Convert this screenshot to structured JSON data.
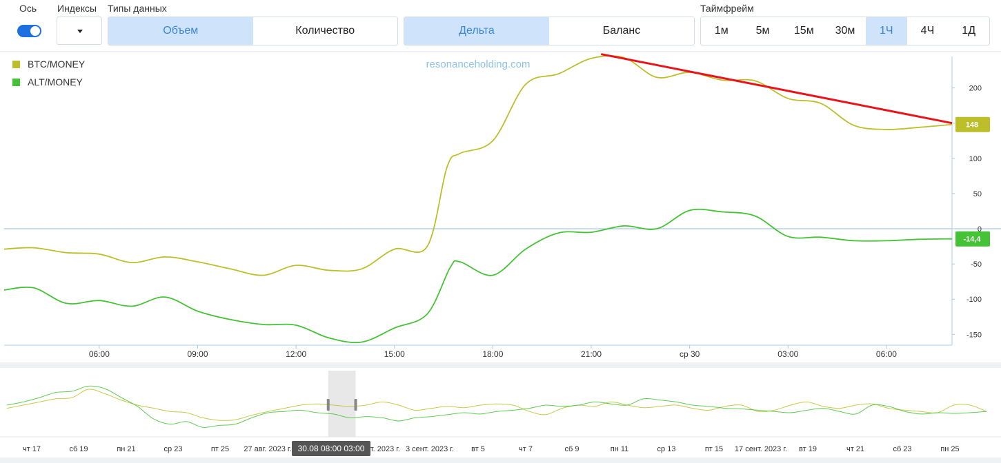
{
  "controls": {
    "axis_label": "Ось",
    "indexes_label": "Индексы",
    "data_types_label": "Типы данных",
    "timeframe_label": "Таймфрейм",
    "data_types": [
      {
        "label": "Объем",
        "active": true
      },
      {
        "label": "Количество",
        "active": false
      }
    ],
    "views": [
      {
        "label": "Дельта",
        "active": true
      },
      {
        "label": "Баланс",
        "active": false
      }
    ],
    "timeframes": [
      {
        "label": "1м",
        "active": false
      },
      {
        "label": "5м",
        "active": false
      },
      {
        "label": "15м",
        "active": false
      },
      {
        "label": "30м",
        "active": false
      },
      {
        "label": "1Ч",
        "active": true
      },
      {
        "label": "4Ч",
        "active": false
      },
      {
        "label": "1Д",
        "active": false
      }
    ]
  },
  "watermark": "resonanceholding.com",
  "colors": {
    "btc": "#bcbf2a",
    "alt": "#45c236",
    "trend": "#e8141b",
    "accent": "#1e6fe0",
    "active_bg": "#cfe4fb",
    "active_text": "#3b86d8",
    "axis": "#a9cbeb",
    "zero_line": "#8fb8de"
  },
  "chart_data": {
    "type": "line",
    "xlabel": "",
    "ylabel": "",
    "ylim": [
      -165,
      250
    ],
    "y_ticks": [
      200,
      150,
      100,
      50,
      0,
      -50,
      -100,
      -150
    ],
    "x_ticks": [
      {
        "label": "06:00",
        "x": 6
      },
      {
        "label": "09:00",
        "x": 9
      },
      {
        "label": "12:00",
        "x": 12
      },
      {
        "label": "15:00",
        "x": 15
      },
      {
        "label": "18:00",
        "x": 18
      },
      {
        "label": "21:00",
        "x": 21
      },
      {
        "label": "ср 30",
        "x": 24
      },
      {
        "label": "03:00",
        "x": 27
      },
      {
        "label": "06:00",
        "x": 30
      }
    ],
    "xlim": [
      3.1,
      32
    ],
    "legend": "top-left",
    "series": [
      {
        "name": "BTC/MONEY",
        "color": "#bcbf2a",
        "last_label": "148",
        "points": [
          [
            3.1,
            -29
          ],
          [
            4,
            -27
          ],
          [
            5,
            -34
          ],
          [
            6,
            -36
          ],
          [
            7,
            -48
          ],
          [
            8,
            -40
          ],
          [
            9,
            -47
          ],
          [
            10,
            -57
          ],
          [
            11,
            -66
          ],
          [
            12,
            -52
          ],
          [
            13,
            -59
          ],
          [
            14,
            -57
          ],
          [
            15,
            -29
          ],
          [
            16,
            -25
          ],
          [
            16.6,
            87
          ],
          [
            17,
            107
          ],
          [
            18,
            125
          ],
          [
            19,
            205
          ],
          [
            20,
            220
          ],
          [
            21,
            242
          ],
          [
            22,
            243
          ],
          [
            23,
            215
          ],
          [
            24,
            222
          ],
          [
            25,
            211
          ],
          [
            26,
            210
          ],
          [
            27,
            185
          ],
          [
            28,
            178
          ],
          [
            29,
            147
          ],
          [
            30,
            141
          ],
          [
            31,
            144
          ],
          [
            32,
            148
          ]
        ]
      },
      {
        "name": "ALT/MONEY",
        "color": "#45c236",
        "last_label": "-14,4",
        "points": [
          [
            3.1,
            -87
          ],
          [
            4,
            -84
          ],
          [
            5,
            -106
          ],
          [
            6,
            -102
          ],
          [
            7,
            -110
          ],
          [
            8,
            -97
          ],
          [
            9,
            -117
          ],
          [
            10,
            -129
          ],
          [
            11,
            -136
          ],
          [
            12,
            -137
          ],
          [
            13,
            -155
          ],
          [
            14,
            -161
          ],
          [
            15,
            -141
          ],
          [
            16,
            -121
          ],
          [
            16.7,
            -55
          ],
          [
            17,
            -47
          ],
          [
            18,
            -66
          ],
          [
            19,
            -29
          ],
          [
            20,
            -6
          ],
          [
            21,
            -5
          ],
          [
            22,
            4
          ],
          [
            23,
            0
          ],
          [
            24,
            26
          ],
          [
            25,
            24
          ],
          [
            26,
            18
          ],
          [
            27,
            -11
          ],
          [
            28,
            -12
          ],
          [
            29,
            -17
          ],
          [
            30,
            -17
          ],
          [
            31,
            -15
          ],
          [
            32,
            -14.4
          ]
        ]
      }
    ],
    "annotations": [
      {
        "type": "trendline",
        "color": "#e8141b",
        "from": [
          21.3,
          248
        ],
        "to": [
          32,
          150
        ]
      }
    ],
    "navigator": {
      "x_ticks": [
        "чт 17",
        "сб 19",
        "пн 21",
        "ср 23",
        "пт 25",
        "27 авг. 2023 г.",
        "30.08 08:00 03:00",
        "1 сент. 2023 г.",
        "3 сент. 2023 г.",
        "вт 5",
        "чт 7",
        "сб 9",
        "пн 11",
        "ср 13",
        "пт 15",
        "17 сент. 2023 г.",
        "вт 19",
        "чт 21",
        "сб 23",
        "пн 25"
      ],
      "cursor_label": "30.08 08:00 03:00",
      "selection": [
        0.328,
        0.356
      ],
      "series": [
        {
          "name": "BTC/MONEY",
          "values": [
            0.45,
            0.5,
            0.55,
            0.6,
            0.62,
            0.75,
            0.68,
            0.58,
            0.5,
            0.45,
            0.4,
            0.38,
            0.3,
            0.26,
            0.27,
            0.34,
            0.4,
            0.45,
            0.5,
            0.52,
            0.5,
            0.48,
            0.5,
            0.55,
            0.5,
            0.42,
            0.45,
            0.48,
            0.46,
            0.5,
            0.52,
            0.5,
            0.4,
            0.35,
            0.45,
            0.5,
            0.48,
            0.55,
            0.5,
            0.46,
            0.48,
            0.5,
            0.45,
            0.42,
            0.48,
            0.5,
            0.4,
            0.42,
            0.5,
            0.55,
            0.48,
            0.45,
            0.5,
            0.52,
            0.45,
            0.42,
            0.4,
            0.38,
            0.5,
            0.5,
            0.4
          ]
        },
        {
          "name": "ALT/MONEY",
          "values": [
            0.5,
            0.55,
            0.62,
            0.7,
            0.72,
            0.8,
            0.76,
            0.62,
            0.48,
            0.28,
            0.2,
            0.24,
            0.15,
            0.18,
            0.2,
            0.3,
            0.38,
            0.4,
            0.42,
            0.38,
            0.36,
            0.3,
            0.32,
            0.3,
            0.25,
            0.3,
            0.32,
            0.35,
            0.38,
            0.36,
            0.4,
            0.42,
            0.45,
            0.5,
            0.48,
            0.5,
            0.55,
            0.52,
            0.5,
            0.6,
            0.58,
            0.55,
            0.5,
            0.48,
            0.45,
            0.44,
            0.42,
            0.4,
            0.38,
            0.42,
            0.45,
            0.4,
            0.36,
            0.5,
            0.48,
            0.4,
            0.36,
            0.38,
            0.37,
            0.38,
            0.4
          ]
        }
      ]
    }
  }
}
